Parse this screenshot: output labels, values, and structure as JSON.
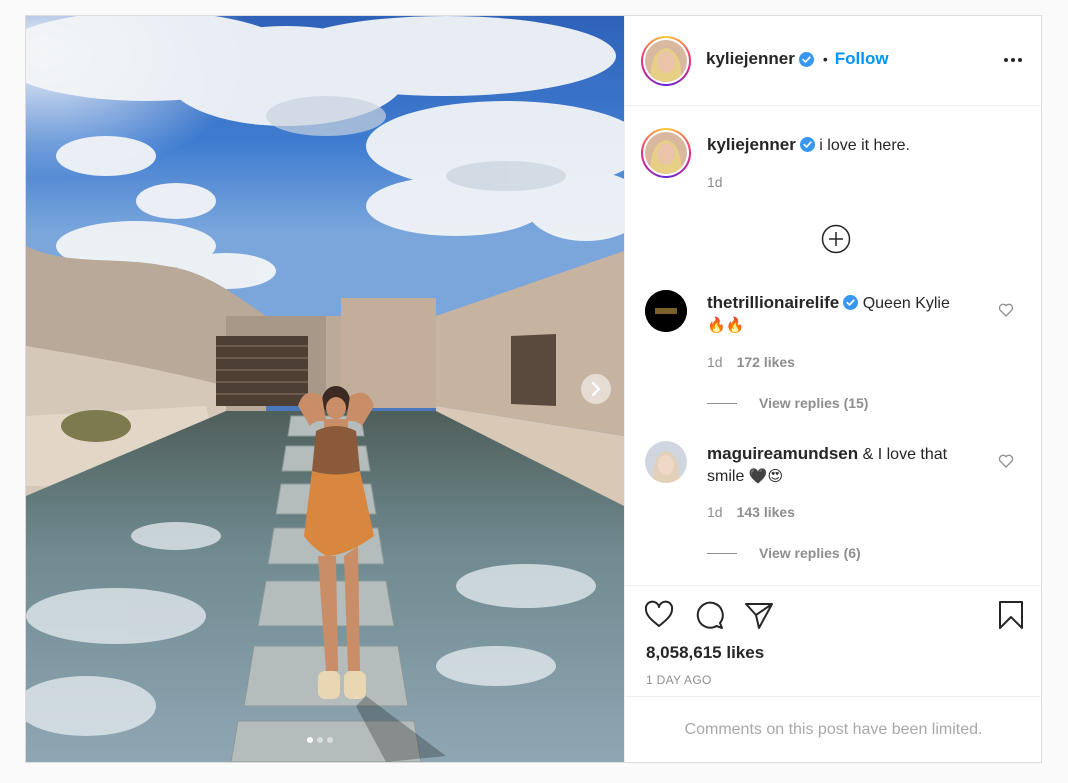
{
  "post": {
    "author": "kyliejenner",
    "follow_label": "Follow",
    "separator": "•",
    "caption": "i love it here.",
    "caption_age": "1d",
    "likes": "8,058,615 likes",
    "posted": "1 DAY AGO",
    "comments_limited": "Comments on this post have been limited.",
    "carousel": {
      "slide_count": 3,
      "active_slide": 1
    }
  },
  "comments": [
    {
      "user": "thetrillionairelife",
      "text": "Queen Kylie",
      "emoji": "🔥🔥",
      "age": "1d",
      "likes": "172 likes",
      "replies": "View replies (15)"
    },
    {
      "user": "maguireamundsen",
      "text": "& I love that smile",
      "emoji": "🖤😍",
      "age": "1d",
      "likes": "143 likes",
      "replies": "View replies (6)"
    }
  ],
  "colors": {
    "accent": "#0095f6",
    "verified": "#3897f0",
    "muted": "#8e8e8e",
    "text": "#262626"
  },
  "icons": [
    "verified-badge-icon",
    "more-options-icon",
    "add-comment-icon",
    "heart-icon",
    "comment-icon",
    "share-icon",
    "bookmark-icon",
    "next-arrow-icon"
  ]
}
